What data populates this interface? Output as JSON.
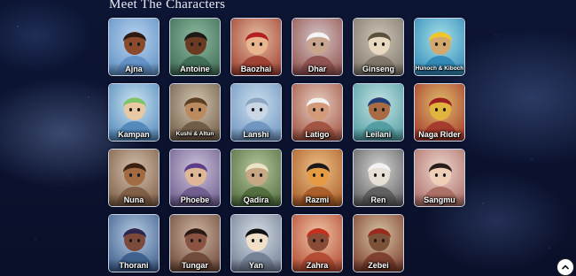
{
  "page": {
    "title": "Meet The Characters"
  },
  "scroll_top": {
    "icon": "chevron-up-icon"
  },
  "characters": [
    {
      "name": "Ajna",
      "colors": [
        "#b9d4ef",
        "#5e8fc4"
      ],
      "skin": "#8a4a2b",
      "hair": "#2a1a12"
    },
    {
      "name": "Antoine",
      "colors": [
        "#8dbba0",
        "#3f6a55"
      ],
      "skin": "#6b3a22",
      "hair": "#1c1a17"
    },
    {
      "name": "Baozhai",
      "colors": [
        "#e9c0a4",
        "#9c3d2f"
      ],
      "skin": "#e8b58f",
      "hair": "#b3201f"
    },
    {
      "name": "Dhar",
      "colors": [
        "#d6c7c7",
        "#8f4f4c"
      ],
      "skin": "#c9a58e",
      "hair": "#f4f4f4"
    },
    {
      "name": "Ginseng",
      "colors": [
        "#cfc7b9",
        "#7d7467"
      ],
      "skin": "#e8d9c0",
      "hair": "#5b4f3e"
    },
    {
      "name": "Hunoch & Kiboch",
      "colors": [
        "#a7e3ea",
        "#2e86b5"
      ],
      "skin": "#d2a86e",
      "hair": "#f0c72b"
    },
    {
      "name": "Kampan",
      "colors": [
        "#cfe7f3",
        "#4f86b9"
      ],
      "skin": "#e8c9a4",
      "hair": "#7ec56a"
    },
    {
      "name": "Kushi & Altun",
      "colors": [
        "#d6c9b4",
        "#6b5843"
      ],
      "skin": "#bb8a5f",
      "hair": "#5c3f27"
    },
    {
      "name": "Lanshi",
      "colors": [
        "#cde0ef",
        "#6d94bf"
      ],
      "skin": "#c8d6e6",
      "hair": "#8fa6c2"
    },
    {
      "name": "Latigo",
      "colors": [
        "#e9d1c4",
        "#9e4f3d"
      ],
      "skin": "#d39a7a",
      "hair": "#f2f2f2"
    },
    {
      "name": "Leilani",
      "colors": [
        "#c8e6e6",
        "#4e9aa0"
      ],
      "skin": "#a86b44",
      "hair": "#1f3d79"
    },
    {
      "name": "Naga Rider",
      "colors": [
        "#e1c06e",
        "#a3352a"
      ],
      "skin": "#e0b43f",
      "hair": "#9d2020"
    },
    {
      "name": "Nuna",
      "colors": [
        "#d4c3b1",
        "#7c5b41"
      ],
      "skin": "#a26b43",
      "hair": "#3a2213"
    },
    {
      "name": "Phoebe",
      "colors": [
        "#cfc6dd",
        "#6b5a8b"
      ],
      "skin": "#e0b796",
      "hair": "#5b3d8a"
    },
    {
      "name": "Qadira",
      "colors": [
        "#b9c8a0",
        "#4f6b3c"
      ],
      "skin": "#c8a785",
      "hair": "#e9e4c6"
    },
    {
      "name": "Razmi",
      "colors": [
        "#f0c48a",
        "#a85a25"
      ],
      "skin": "#e69b42",
      "hair": "#1a1a1a"
    },
    {
      "name": "Ren",
      "colors": [
        "#d7d7d7",
        "#5b5b5b"
      ],
      "skin": "#e6e0d6",
      "hair": "#f2f2f2"
    },
    {
      "name": "Sangmu",
      "colors": [
        "#f0d8d2",
        "#a86b62"
      ],
      "skin": "#f0cfb8",
      "hair": "#2b1d1a"
    },
    {
      "name": "Thorani",
      "colors": [
        "#b9cde6",
        "#3a5c8a"
      ],
      "skin": "#7b4a3a",
      "hair": "#2b2550"
    },
    {
      "name": "Tungar",
      "colors": [
        "#d1b8a6",
        "#6b4636"
      ],
      "skin": "#8a5240",
      "hair": "#2a1a14"
    },
    {
      "name": "Yan",
      "colors": [
        "#d8dfe8",
        "#6f7d92"
      ],
      "skin": "#f2dfc8",
      "hair": "#111111"
    },
    {
      "name": "Zahra",
      "colors": [
        "#f2c7a8",
        "#b0472f"
      ],
      "skin": "#8a4b36",
      "hair": "#c4301e"
    },
    {
      "name": "Zebei",
      "colors": [
        "#d8c6a4",
        "#7a3a2a"
      ],
      "skin": "#7b5238",
      "hair": "#9a2a1e"
    }
  ]
}
